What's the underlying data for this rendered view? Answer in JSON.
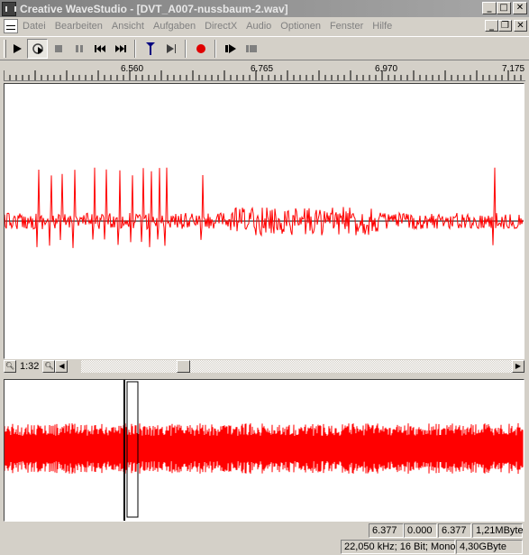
{
  "window": {
    "title": "Creative WaveStudio - [DVT_A007-nussbaum-2.wav]"
  },
  "menu": {
    "items": [
      "Datei",
      "Bearbeiten",
      "Ansicht",
      "Aufgaben",
      "DirectX",
      "Audio",
      "Optionen",
      "Fenster",
      "Hilfe"
    ]
  },
  "toolbar": {
    "buttons": [
      "play-icon",
      "loop-play-icon",
      "stop-icon",
      "pause-icon",
      "skip-back-icon",
      "skip-forward-icon",
      "marker-icon",
      "play-to-marker-icon",
      "record-icon",
      "play-selection-icon",
      "stop-selection-icon"
    ]
  },
  "ruler": {
    "labels": [
      "6.560",
      "6.765",
      "6.970",
      "7.175"
    ]
  },
  "main_view": {
    "zoom_label": "1:32",
    "wave_color": "#ff0000"
  },
  "status": {
    "position": "6.377",
    "selection_start": "0.000",
    "selection_end": "6.377",
    "file_size": "1,21MByte",
    "format": "22,050 kHz; 16 Bit; Mono",
    "disk_free": "4,30GByte"
  }
}
